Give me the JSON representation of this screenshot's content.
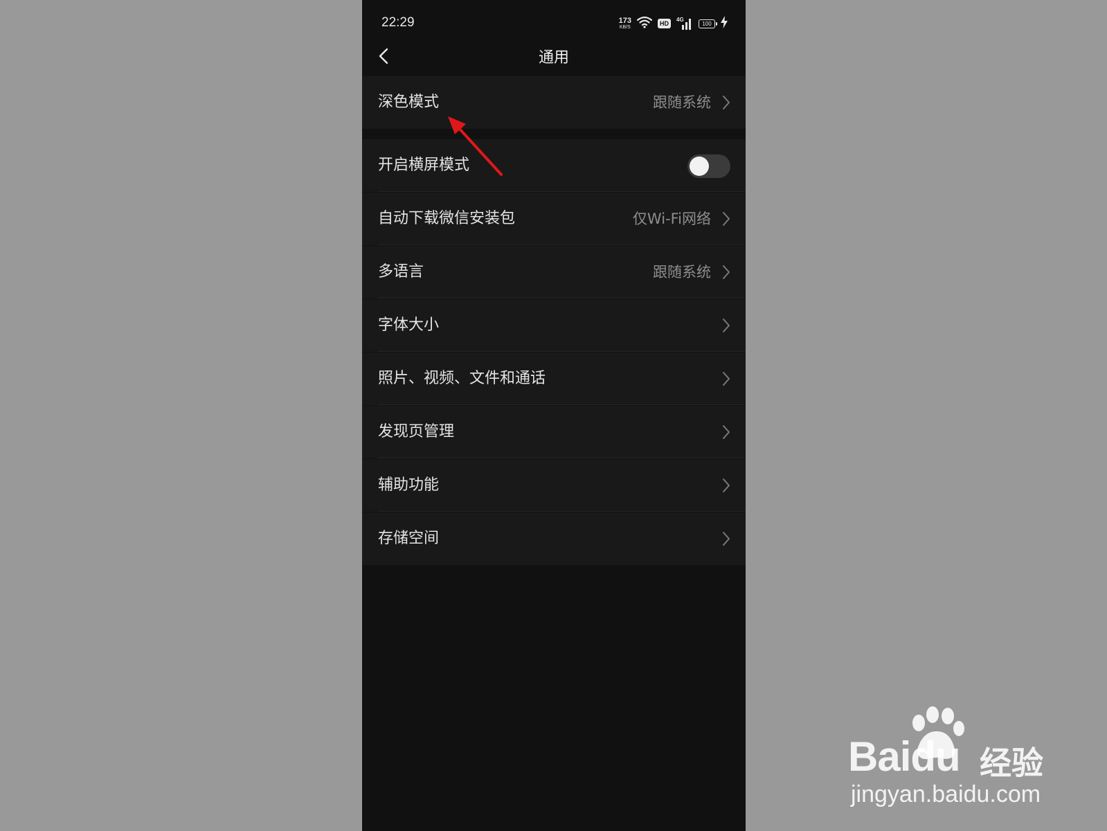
{
  "status_bar": {
    "time": "22:29",
    "net_speed_value": "173",
    "net_speed_unit": "KB/S",
    "hd_label": "HD",
    "network_type": "4G",
    "battery_level": "100"
  },
  "header": {
    "title": "通用",
    "back_icon": "chevron-left-icon"
  },
  "settings": {
    "dark_mode": {
      "label": "深色模式",
      "value": "跟随系统"
    },
    "landscape": {
      "label": "开启横屏模式",
      "toggle_on": false
    },
    "auto_download": {
      "label": "自动下载微信安装包",
      "value": "仅Wi-Fi网络"
    },
    "language": {
      "label": "多语言",
      "value": "跟随系统"
    },
    "font_size": {
      "label": "字体大小"
    },
    "media": {
      "label": "照片、视频、文件和通话"
    },
    "discover": {
      "label": "发现页管理"
    },
    "accessibility": {
      "label": "辅助功能"
    },
    "storage": {
      "label": "存储空间"
    }
  },
  "colors": {
    "backdrop": "#999999",
    "page_background": "#111111",
    "row_background": "#191919",
    "annotation_arrow": "#e0171a"
  },
  "watermark": {
    "brand": "Baidu",
    "suffix": "经验",
    "url": "jingyan.baidu.com"
  }
}
